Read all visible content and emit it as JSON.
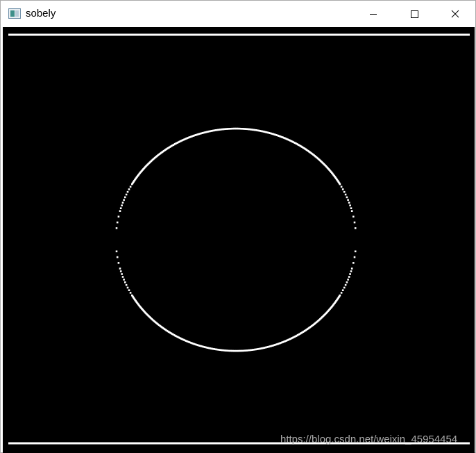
{
  "window": {
    "title": "sobely",
    "app_icon": "opencv-window-icon",
    "controls": [
      {
        "name": "minimize",
        "icon": "minimize-icon"
      },
      {
        "name": "maximize",
        "icon": "maximize-icon"
      },
      {
        "name": "close",
        "icon": "close-icon"
      }
    ]
  },
  "image": {
    "description_colors": {
      "background": "#000000",
      "edges": "#ffffff"
    },
    "edges": [
      "top-horizontal-line",
      "circle-outline",
      "bottom-horizontal-line"
    ]
  },
  "watermark": {
    "text": "https://blog.csdn.net/weixin_45954454"
  }
}
